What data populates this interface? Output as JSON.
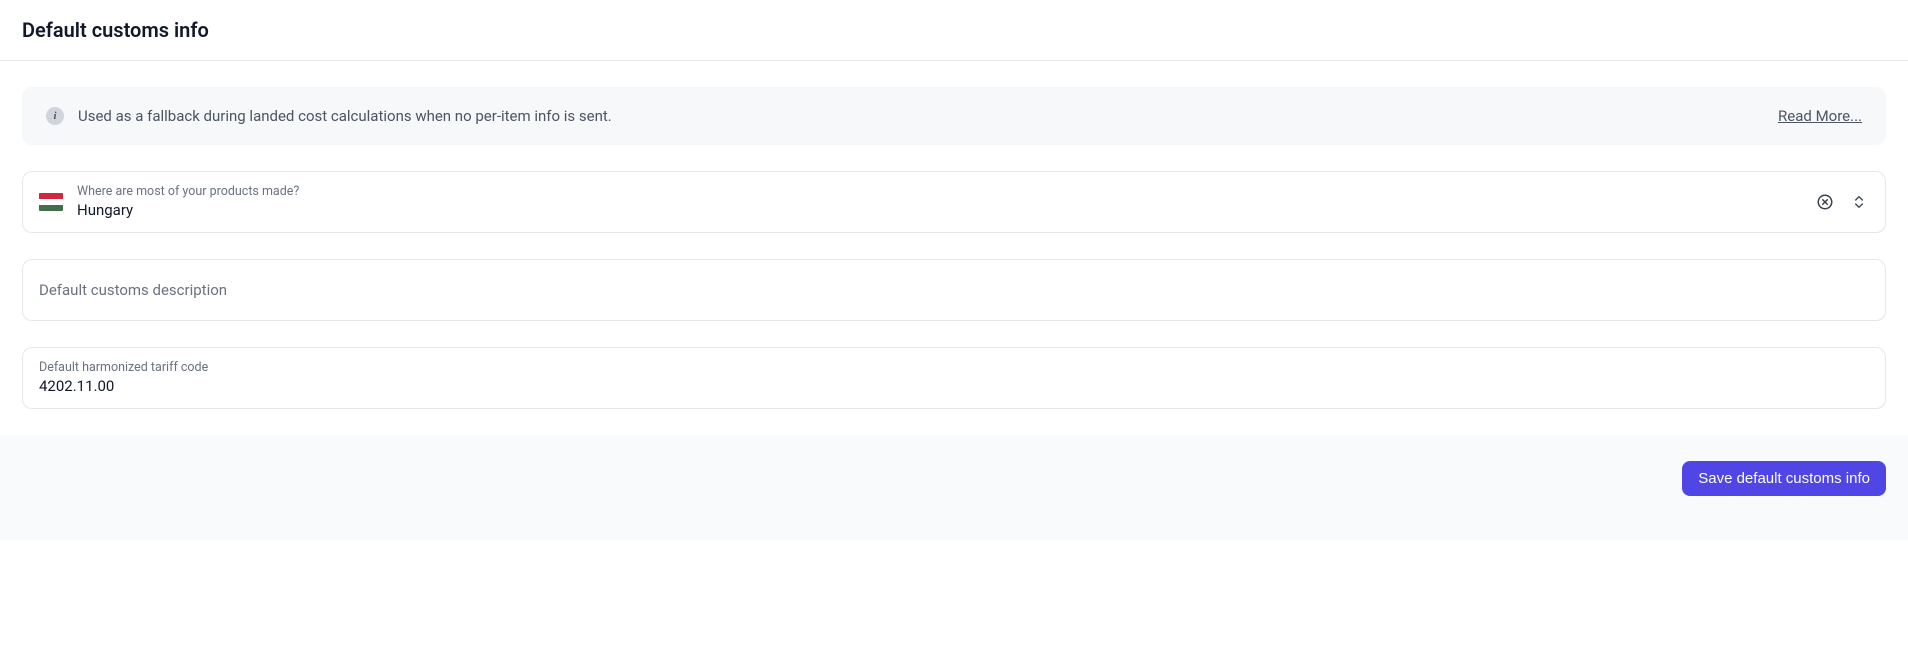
{
  "header": {
    "title": "Default customs info"
  },
  "banner": {
    "text": "Used as a fallback during landed cost calculations when no per-item info is sent.",
    "read_more": "Read More...",
    "icon_glyph": "i"
  },
  "country_field": {
    "label": "Where are most of your products made?",
    "value": "Hungary",
    "flag_colors": {
      "top": "#cd2a3e",
      "middle": "#ffffff",
      "bottom": "#436f4d"
    }
  },
  "description_field": {
    "placeholder": "Default customs description",
    "value": ""
  },
  "tariff_field": {
    "label": "Default harmonized tariff code",
    "value": "4202.11.00"
  },
  "footer": {
    "save_label": "Save default customs info"
  }
}
